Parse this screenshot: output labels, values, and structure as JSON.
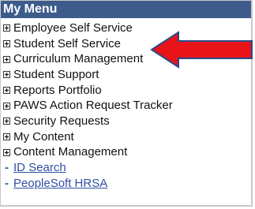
{
  "menu": {
    "title": "My Menu",
    "items": [
      {
        "label": "Employee Self Service",
        "kind": "folder",
        "icon": "expand-plus-icon"
      },
      {
        "label": "Student Self Service",
        "kind": "folder",
        "icon": "expand-plus-icon"
      },
      {
        "label": "Curriculum Management",
        "kind": "folder",
        "icon": "expand-plus-icon"
      },
      {
        "label": "Student Support",
        "kind": "folder",
        "icon": "expand-plus-icon"
      },
      {
        "label": "Reports Portfolio",
        "kind": "folder",
        "icon": "expand-plus-icon"
      },
      {
        "label": "PAWS Action Request Tracker",
        "kind": "folder",
        "icon": "expand-plus-icon"
      },
      {
        "label": "Security Requests",
        "kind": "folder",
        "icon": "expand-plus-icon"
      },
      {
        "label": "My Content",
        "kind": "folder",
        "icon": "expand-plus-icon"
      },
      {
        "label": "Content Management",
        "kind": "folder",
        "icon": "expand-plus-icon"
      },
      {
        "label": "ID Search",
        "kind": "link",
        "icon": "dash-bullet"
      },
      {
        "label": "PeopleSoft HRSA",
        "kind": "link",
        "icon": "dash-bullet"
      }
    ]
  },
  "colors": {
    "header_bg": "#3d5c8c",
    "header_text": "#ffffff",
    "link_text": "#2f4fa2",
    "arrow_fill": "#e8141a",
    "arrow_outline": "#2a4a8a"
  },
  "annotation": {
    "icon": "red-arrow-pointer",
    "points_to": "Student Self Service"
  }
}
